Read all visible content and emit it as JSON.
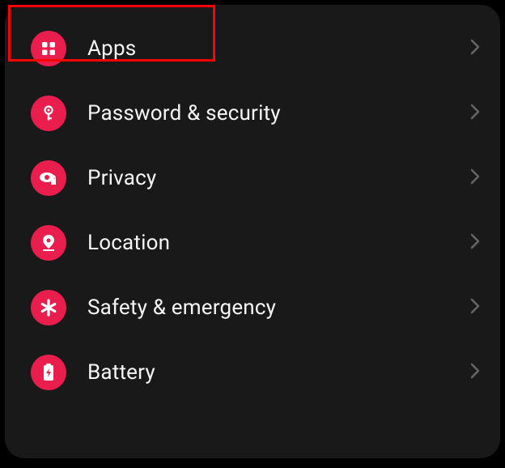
{
  "settings": {
    "items": [
      {
        "label": "Apps",
        "icon": "apps-icon",
        "highlighted": true
      },
      {
        "label": "Password & security",
        "icon": "key-icon",
        "highlighted": false
      },
      {
        "label": "Privacy",
        "icon": "privacy-icon",
        "highlighted": false
      },
      {
        "label": "Location",
        "icon": "location-icon",
        "highlighted": false
      },
      {
        "label": "Safety & emergency",
        "icon": "asterisk-icon",
        "highlighted": false
      },
      {
        "label": "Battery",
        "icon": "battery-icon",
        "highlighted": false
      }
    ]
  },
  "colors": {
    "accent": "#e91e4d",
    "background": "#191919",
    "text": "#f5f5f5",
    "chevron": "#666",
    "highlight": "#ff0000"
  }
}
